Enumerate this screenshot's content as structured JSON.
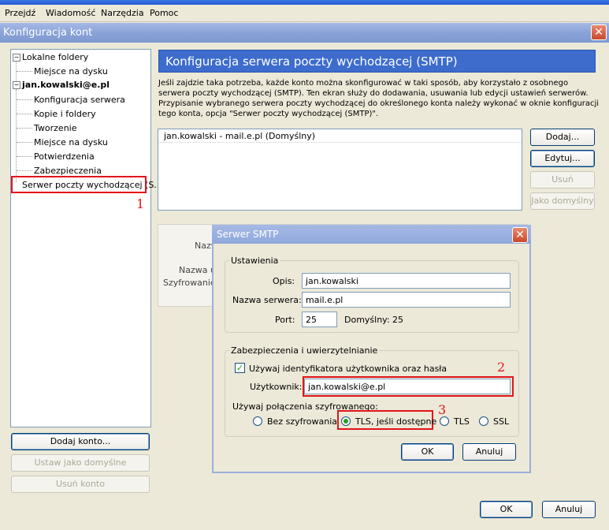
{
  "menu": [
    "Przejdź",
    "Wiadomość",
    "Narzędzia",
    "Pomoc"
  ],
  "window": {
    "title": "Konfiguracja kont",
    "close": "✕"
  },
  "tree": {
    "local": "Lokalne foldery",
    "local_children": [
      "Miejsce na dysku"
    ],
    "account": "jan.kowalski@e.pl",
    "account_children": [
      "Konfiguracja serwera",
      "Kopie i foldery",
      "Tworzenie",
      "Miejsce na dysku",
      "Potwierdzenia",
      "Zabezpieczenia",
      "Serwer poczty wychodzącej (S..."
    ],
    "marker": "1"
  },
  "left_buttons": {
    "add": "Dodaj konto...",
    "default": "Ustaw jako domyślne",
    "remove": "Usuń konto"
  },
  "smtp": {
    "header": "Konfiguracja serwera poczty wychodzącej (SMTP)",
    "description": "Jeśli zajdzie taka potrzeba, każde konto można skonfigurować w taki sposób, aby korzystało z osobnego serwera poczty wychodzącej (SMTP). Ten ekran służy do dodawania, usuwania lub edycji ustawień serwerów. Przypisanie wybranego serwera poczty wychodzącej do określonego konta należy wykonać w oknie konfiguracji tego konta, opcja \"Serwer poczty wychodzącej (SMTP)\".",
    "servers": [
      "jan.kowalski - mail.e.pl (Domyślny)"
    ],
    "buttons": {
      "add": "Dodaj...",
      "edit": "Edytuj...",
      "remove": "Usuń",
      "default": "Jako domyślny"
    },
    "details": {
      "name_label": "Nazw",
      "user_label": "Nazwa u",
      "enc_label": "Szyfrowanie"
    }
  },
  "dialog": {
    "title": "Serwer SMTP",
    "settings_group": "Ustawienia",
    "desc_label": "Opis:",
    "desc_value": "jan.kowalski",
    "server_label": "Nazwa serwera:",
    "server_value": "mail.e.pl",
    "port_label": "Port:",
    "port_value": "25",
    "port_default_label": "Domyślny:",
    "port_default_value": "25",
    "security_group": "Zabezpieczenia i uwierzytelnianie",
    "use_auth_label": "Używaj identyfikatora użytkownika oraz hasła",
    "use_auth_checked": true,
    "user_label": "Użytkownik:",
    "user_value": "jan.kowalski@e.pl",
    "marker2": "2",
    "enc_label": "Używaj połączenia szyfrowanego:",
    "enc_options": [
      "Bez szyfrowania",
      "TLS, jeśli dostępne",
      "TLS",
      "SSL"
    ],
    "enc_selected": "TLS, jeśli dostępne",
    "marker3": "3",
    "ok": "OK",
    "cancel": "Anuluj"
  },
  "footer": {
    "ok": "OK",
    "cancel": "Anuluj"
  }
}
